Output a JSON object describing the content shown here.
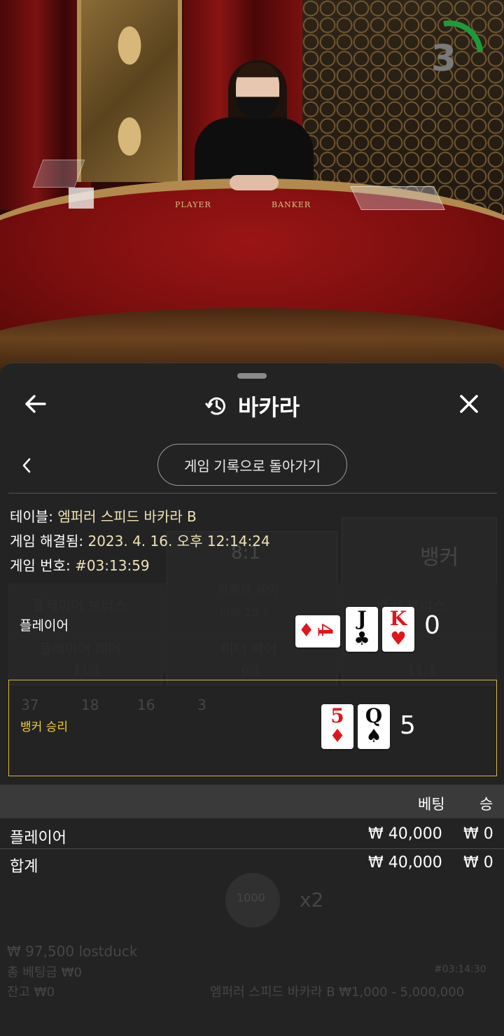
{
  "video": {
    "timer_value": "3",
    "table_labels": {
      "player": "PLAYER",
      "banker": "BANKER"
    }
  },
  "sheet": {
    "title": "바카라",
    "icons": {
      "back": "arrow-left-icon",
      "history": "history-icon",
      "close": "close-icon",
      "chevron": "chevron-left-icon"
    },
    "back_to_history_label": "게임 기록으로 돌아가기",
    "info": {
      "table_label": "테이블:",
      "table_value": "엠퍼러 스피드 바카라 B",
      "resolved_label": "게임 해결됨:",
      "resolved_value": "2023. 4. 16. 오후 12:14:24",
      "number_label": "게임 번호:",
      "number_value": "#03:13:59"
    },
    "player_hand": {
      "label": "플레이어",
      "cards": [
        {
          "rank": "4",
          "suit": "♦",
          "color": "red",
          "sideways": true
        },
        {
          "rank": "J",
          "suit": "♣",
          "color": "black"
        },
        {
          "rank": "K",
          "suit": "♥",
          "color": "red"
        }
      ],
      "score": "0"
    },
    "banker_hand": {
      "label": "뱅커 승리",
      "cards": [
        {
          "rank": "5",
          "suit": "♦",
          "color": "red"
        },
        {
          "rank": "Q",
          "suit": "♠",
          "color": "black"
        }
      ],
      "score": "5"
    },
    "bet_table": {
      "headers": {
        "bet": "베팅",
        "win": "승"
      },
      "rows": [
        {
          "name": "플레이어",
          "bet": "₩ 40,000",
          "win": "₩ 0"
        }
      ],
      "total": {
        "name": "합계",
        "bet": "₩ 40,000",
        "win": "₩ 0"
      }
    }
  },
  "background_game": {
    "player_bonus": "플레이어 보너스",
    "perfect_pair": "퍼펙트 페어",
    "player_pair": "플레이어 페어",
    "either_pair": "이더 페어",
    "banker": "뱅커",
    "banker_bonus": "뱅커 보너스",
    "odds_8_1": "8:1",
    "odds_11_1": "11:1",
    "odds_6_1": "6:1",
    "odds_25_1": "이나 25:1",
    "count_p": "37",
    "count_b": "18",
    "count_t": "16",
    "count_x": "3",
    "chip": "1000",
    "multiplier": "x2",
    "balance_line": "₩ 97,500 lostduck",
    "total_bet": "총 베팅금 ₩0",
    "balance": "잔고 ₩0",
    "table_limits": "엠퍼러 스피드 바카라 B ₩1,000 - 5,000,000",
    "game_id": "#03:14:30"
  }
}
